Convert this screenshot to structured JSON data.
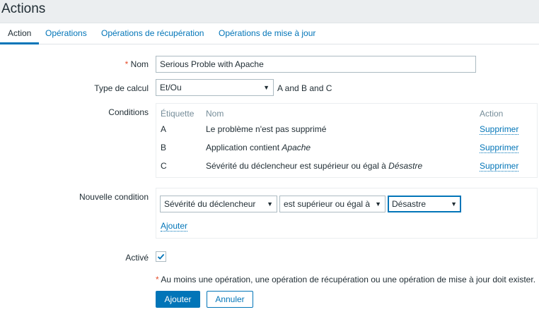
{
  "page": {
    "title": "Actions"
  },
  "tabs": [
    {
      "label": "Action"
    },
    {
      "label": "Opérations"
    },
    {
      "label": "Opérations de récupération"
    },
    {
      "label": "Opérations de mise à jour"
    }
  ],
  "form": {
    "name": {
      "required_marker": "*",
      "label": "Nom",
      "value": "Serious Proble with Apache"
    },
    "calc": {
      "label": "Type de calcul",
      "selected": "Et/Ou",
      "formula": "A and B and C"
    },
    "conditions": {
      "label": "Conditions",
      "headers": {
        "tag": "Étiquette",
        "name": "Nom",
        "action": "Action"
      },
      "rows": [
        {
          "tag": "A",
          "text": "Le problème n'est pas supprimé",
          "emph": "",
          "action": "Supprimer"
        },
        {
          "tag": "B",
          "text": "Application contient ",
          "emph": "Apache",
          "action": "Supprimer"
        },
        {
          "tag": "C",
          "text": "Sévérité du déclencheur est supérieur ou égal à ",
          "emph": "Désastre",
          "action": "Supprimer"
        }
      ]
    },
    "new_condition": {
      "label": "Nouvelle condition",
      "type_selected": "Sévérité du déclencheur",
      "operator_selected": "est supérieur ou égal à",
      "value_selected": "Désastre",
      "add_link": "Ajouter"
    },
    "enabled": {
      "label": "Activé",
      "checked": true
    },
    "warning": {
      "marker": "*",
      "text": " Au moins une opération, une opération de récupération ou une opération de mise à jour doit exister."
    },
    "buttons": {
      "add": "Ajouter",
      "cancel": "Annuler"
    }
  },
  "colors": {
    "accent": "#0275b8",
    "required": "#e54e2c",
    "background": "#ebeef0"
  }
}
